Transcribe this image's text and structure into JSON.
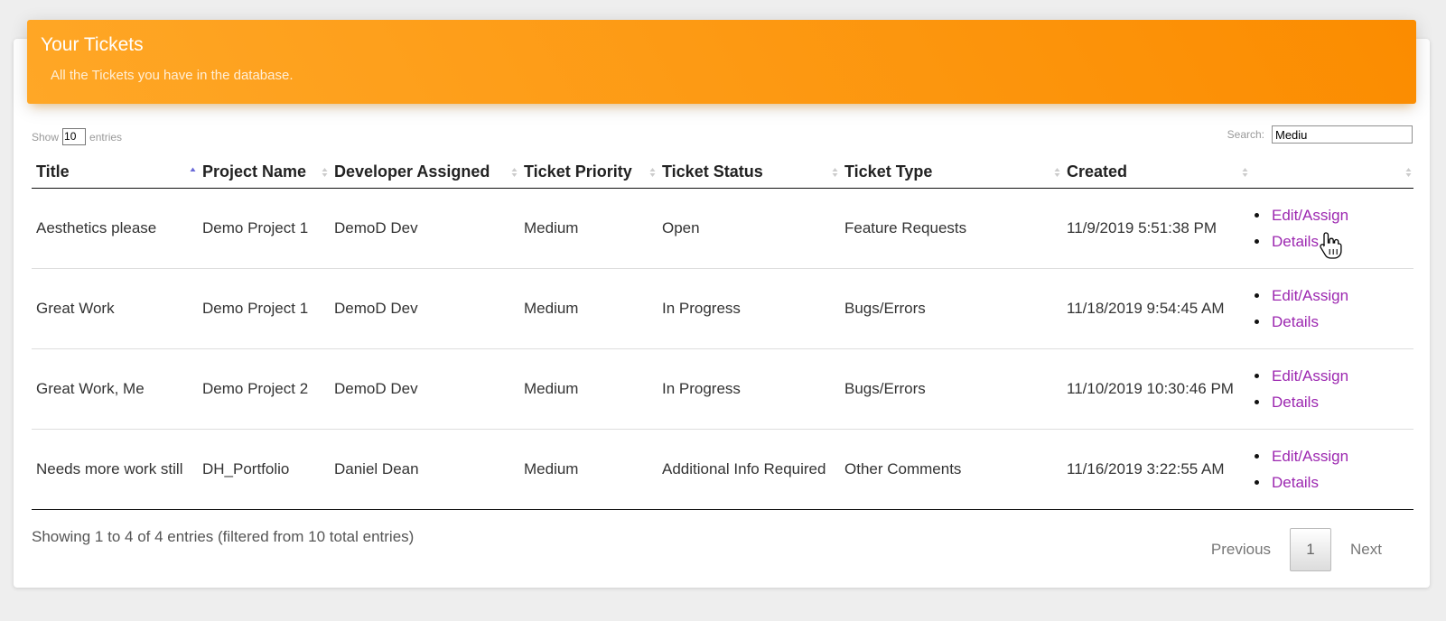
{
  "header": {
    "title": "Your Tickets",
    "subtitle": "All the Tickets you have in the database."
  },
  "length_control": {
    "show_label": "Show",
    "value": "10",
    "entries_label": "entries"
  },
  "search": {
    "label": "Search:",
    "value": "Mediu"
  },
  "table": {
    "columns": [
      {
        "label": "Title",
        "sort": "asc"
      },
      {
        "label": "Project Name",
        "sort": "none"
      },
      {
        "label": "Developer Assigned",
        "sort": "none"
      },
      {
        "label": "Ticket Priority",
        "sort": "none"
      },
      {
        "label": "Ticket Status",
        "sort": "none"
      },
      {
        "label": "Ticket Type",
        "sort": "none"
      },
      {
        "label": "Created",
        "sort": "none"
      },
      {
        "label": "",
        "sort": "none"
      }
    ],
    "rows": [
      {
        "title": "Aesthetics please",
        "project": "Demo Project 1",
        "developer": "DemoD Dev",
        "priority": "Medium",
        "status": "Open",
        "type": "Feature Requests",
        "created": "11/9/2019 5:51:38 PM",
        "edit_label": "Edit/Assign",
        "details_label": "Details"
      },
      {
        "title": "Great Work",
        "project": "Demo Project 1",
        "developer": "DemoD Dev",
        "priority": "Medium",
        "status": "In Progress",
        "type": "Bugs/Errors",
        "created": "11/18/2019 9:54:45 AM",
        "edit_label": "Edit/Assign",
        "details_label": "Details"
      },
      {
        "title": "Great Work, Me",
        "project": "Demo Project 2",
        "developer": "DemoD Dev",
        "priority": "Medium",
        "status": "In Progress",
        "type": "Bugs/Errors",
        "created": "11/10/2019 10:30:46 PM",
        "edit_label": "Edit/Assign",
        "details_label": "Details"
      },
      {
        "title": "Needs more work still",
        "project": "DH_Portfolio",
        "developer": "Daniel Dean",
        "priority": "Medium",
        "status": "Additional Info Required",
        "type": "Other Comments",
        "created": "11/16/2019 3:22:55 AM",
        "edit_label": "Edit/Assign",
        "details_label": "Details"
      }
    ]
  },
  "footer": {
    "info": "Showing 1 to 4 of 4 entries (filtered from 10 total entries)",
    "previous_label": "Previous",
    "current_page": "1",
    "next_label": "Next"
  },
  "colors": {
    "header_gradient_start": "#ffa726",
    "header_gradient_end": "#fb8c00",
    "link": "#9c27b0",
    "sort_active": "#6a6ad8",
    "sort_inactive": "#cccccc"
  }
}
